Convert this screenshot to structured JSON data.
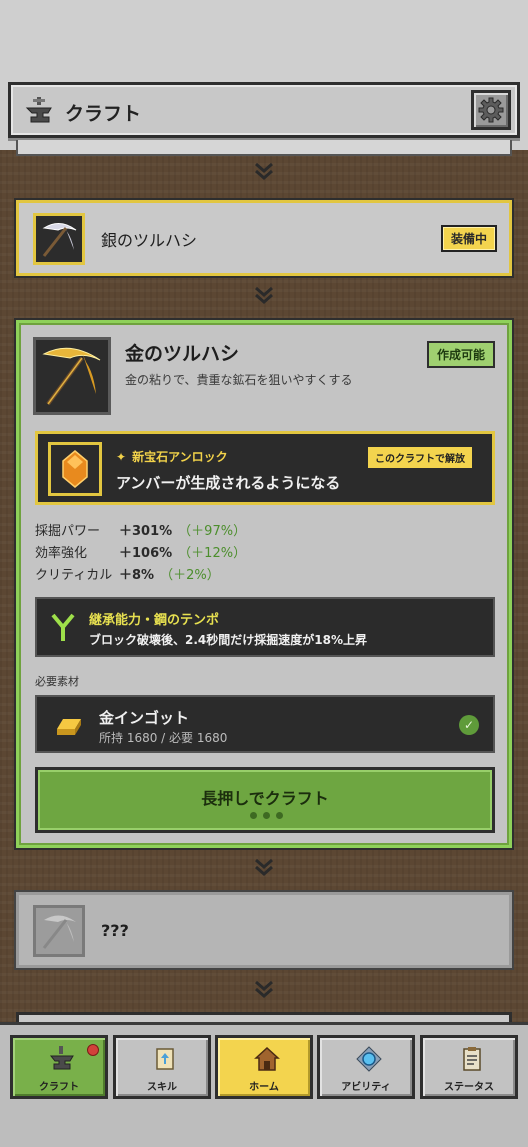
{
  "header": {
    "title": "クラフト",
    "settings_icon": "gear-icon"
  },
  "equipped_item": {
    "name": "銀のツルハシ",
    "badge": "装備中",
    "icon": "silver-pickaxe-icon"
  },
  "craft_item": {
    "name": "金のツルハシ",
    "badge": "作成可能",
    "description": "金の粘りで、貴重な鉱石を狙いやすくする",
    "icon": "gold-pickaxe-icon",
    "unlock": {
      "label": "新宝石アンロック",
      "text": "アンバーが生成されるようになる",
      "badge": "このクラフトで解放",
      "icon": "amber-gem-icon"
    },
    "stats": [
      {
        "label": "採掘パワー",
        "value": "＋301%",
        "diff": "（＋97%）"
      },
      {
        "label": "効率強化",
        "value": "＋106%",
        "diff": "（＋12%）"
      },
      {
        "label": "クリティカル",
        "value": "＋8%",
        "diff": "（＋2%）"
      }
    ],
    "inherit": {
      "title": "継承能力・鋼のテンポ",
      "description": "ブロック破壊後、2.4秒間だけ採掘速度が18%上昇"
    },
    "required_label": "必要素材",
    "material": {
      "name": "金インゴット",
      "count": "所持 1680 / 必要 1680",
      "icon": "gold-ingot-icon"
    },
    "craft_button": "長押しでクラフト"
  },
  "locked_item": {
    "name": "???"
  },
  "nav": [
    {
      "label": "クラフト",
      "icon": "anvil-icon"
    },
    {
      "label": "スキル",
      "icon": "scroll-icon"
    },
    {
      "label": "ホーム",
      "icon": "house-icon"
    },
    {
      "label": "アビリティ",
      "icon": "orb-icon"
    },
    {
      "label": "ステータス",
      "icon": "clipboard-icon"
    }
  ],
  "colors": {
    "accent_gold": "#f3d44e",
    "accent_green": "#6ea641",
    "background": "#5c4733"
  }
}
